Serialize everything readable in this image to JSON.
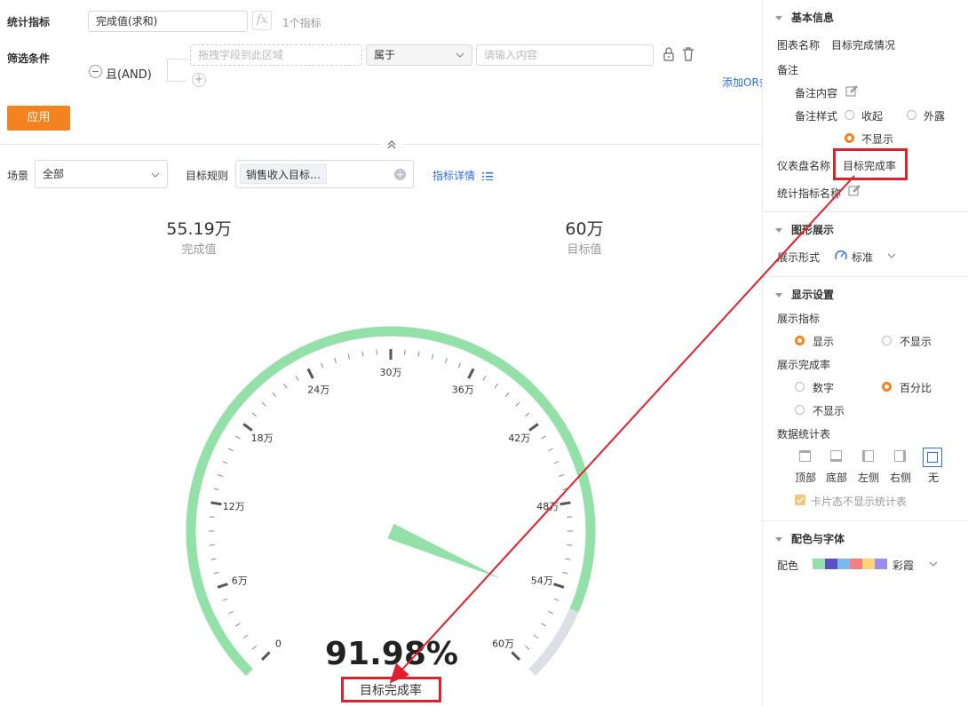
{
  "filters": {
    "metric_label": "统计指标",
    "metric_value": "完成值(求和)",
    "fx_label": "fx",
    "metric_count": "1个指标",
    "filter_label": "筛选条件",
    "and_label": "且(AND)",
    "drag_placeholder": "拖拽字段到此区域",
    "operator_value": "属于",
    "content_placeholder": "请输入内容",
    "add_or": "添加OR条",
    "apply_button": "应用"
  },
  "toolbar": {
    "scene_label": "场景",
    "scene_value": "全部",
    "rule_label": "目标规则",
    "rule_tag": "销售收入目标…",
    "rule_detail_link": "指标详情"
  },
  "summary": {
    "completed_value": "55.19万",
    "completed_label": "完成值",
    "target_value": "60万",
    "target_label": "目标值"
  },
  "chart_data": {
    "type": "gauge",
    "min": 0,
    "max": 60,
    "unit": "万",
    "value": 55.19,
    "target": 60,
    "percent": 91.98,
    "percent_text": "91.98%",
    "name": "目标完成率",
    "tick_labels": [
      "0",
      "6万",
      "12万",
      "18万",
      "24万",
      "30万",
      "36万",
      "42万",
      "48万",
      "54万",
      "60万"
    ],
    "colors": {
      "progress": "#93e0a8",
      "remain": "#dcdfe6",
      "needle": "#93e0a8"
    }
  },
  "panel": {
    "basic_info_title": "基本信息",
    "chart_name_label": "图表名称",
    "chart_name_value": "目标完成情况",
    "remark_label": "备注",
    "remark_content_label": "备注内容",
    "remark_style_label": "备注样式",
    "remark_opt_collapse": "收起",
    "remark_opt_expose": "外露",
    "remark_opt_hide": "不显示",
    "dashboard_name_label": "仪表盘名称",
    "dashboard_name_value": "目标完成率",
    "metric_name_label": "统计指标名称",
    "graph_title": "图形展示",
    "display_form_label": "展示形式",
    "display_form_value": "标准",
    "display_settings_title": "显示设置",
    "show_metric_label": "展示指标",
    "show_metric_on": "显示",
    "show_metric_off": "不显示",
    "show_rate_label": "展示完成率",
    "show_rate_number": "数字",
    "show_rate_percent": "百分比",
    "show_rate_hide": "不显示",
    "stat_table_label": "数据统计表",
    "stat_top": "顶部",
    "stat_bottom": "底部",
    "stat_left": "左侧",
    "stat_right": "右侧",
    "stat_none": "无",
    "card_no_table": "卡片态不显示统计表",
    "color_font_title": "配色与字体",
    "color_label": "配色",
    "palette_name": "彩霞",
    "palette": [
      "#93e0a8",
      "#5b4fc6",
      "#7ab8f0",
      "#f77e7e",
      "#ffd27a",
      "#9b8df0"
    ]
  },
  "annotation": {
    "color": "#e0202a"
  }
}
